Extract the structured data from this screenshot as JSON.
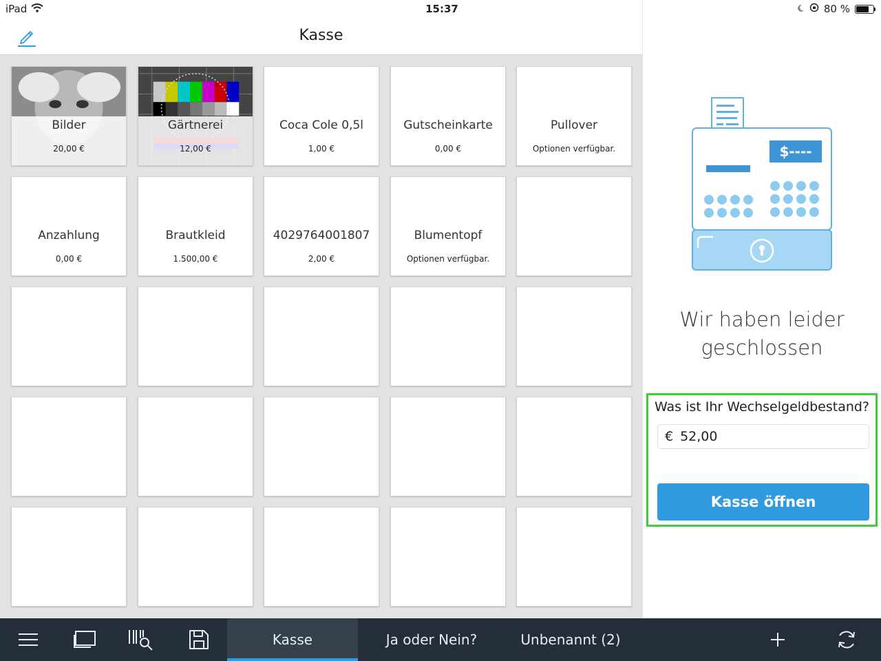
{
  "status_bar": {
    "device": "iPad",
    "time": "15:37",
    "battery": "80 %",
    "battery_level": 0.8
  },
  "header": {
    "title": "Kasse",
    "edit_icon": "pencil-icon"
  },
  "tiles": [
    {
      "name": "Bilder",
      "sub": "20,00 €",
      "image": "photo"
    },
    {
      "name": "Gärtnerei",
      "sub": "12,00 €",
      "image": "testcard"
    },
    {
      "name": "Coca Cole 0,5l",
      "sub": "1,00 €"
    },
    {
      "name": "Gutscheinkarte",
      "sub": "0,00 €"
    },
    {
      "name": "Pullover",
      "sub": "Optionen verfügbar."
    },
    {
      "name": "Anzahlung",
      "sub": "0,00 €"
    },
    {
      "name": "Brautkleid",
      "sub": "1.500,00 €"
    },
    {
      "name": "4029764001807",
      "sub": "2,00 €"
    },
    {
      "name": "Blumentopf",
      "sub": "Optionen verfügbar."
    }
  ],
  "right_panel": {
    "illustration": "cash-register-icon",
    "register_display": "$----",
    "closed_message_line1": "Wir haben leider",
    "closed_message_line2": "geschlossen",
    "cash_label": "Was ist Ihr Wechselgeldbestand?",
    "currency_symbol": "€",
    "cash_value": "52,00",
    "open_button": "Kasse öffnen",
    "highlight_color": "#3fcc3f",
    "accent_color": "#2f9bde"
  },
  "bottom_bar": {
    "icons": [
      "menu-icon",
      "screens-icon",
      "barcode-search-icon",
      "save-icon"
    ],
    "tabs": [
      {
        "label": "Kasse",
        "active": true
      },
      {
        "label": "Ja oder Nein?",
        "active": false
      },
      {
        "label": "Unbenannt (2)",
        "active": false
      }
    ],
    "right_icons": [
      "plus-icon",
      "sync-icon"
    ]
  }
}
